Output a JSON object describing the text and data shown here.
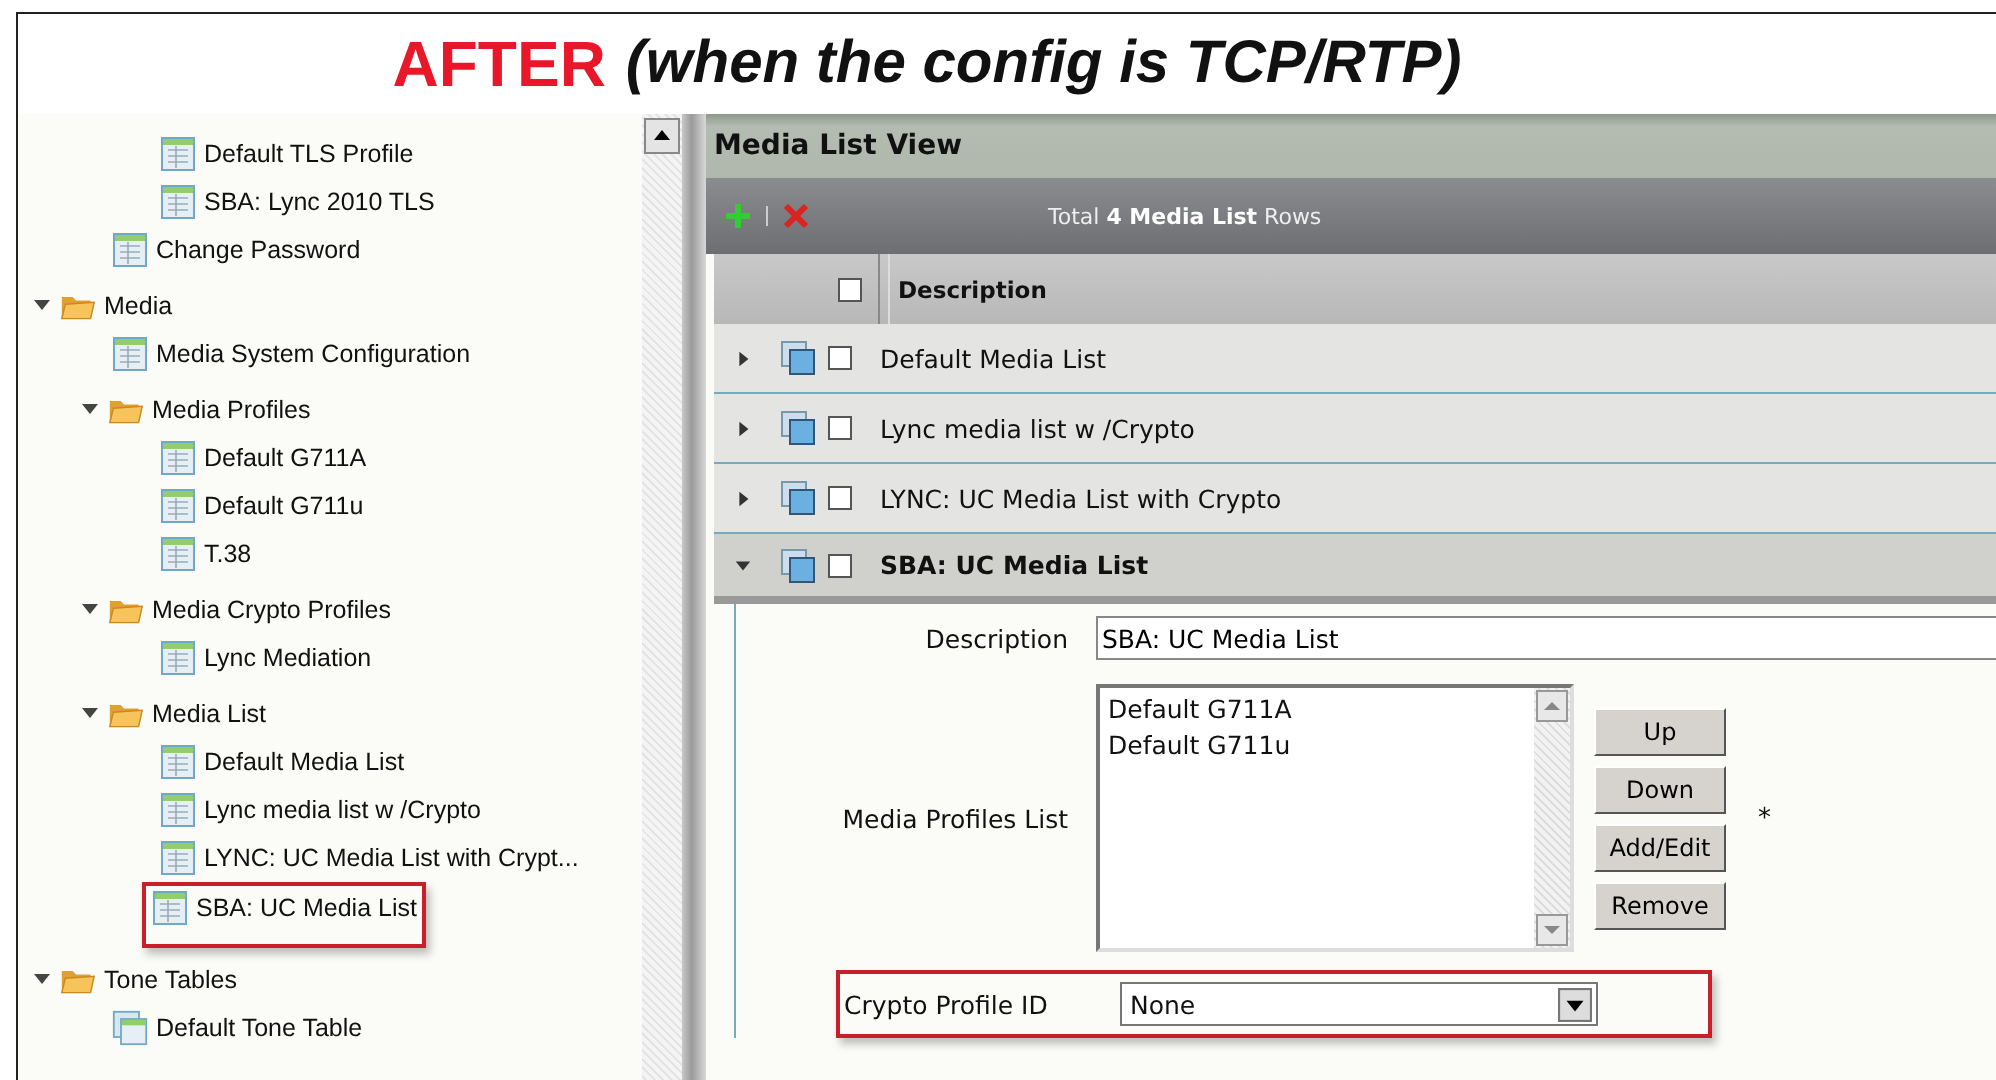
{
  "banner": {
    "emphasis": "AFTER",
    "text": "(when the config is TCP/RTP)"
  },
  "tree": [
    {
      "children": [
        {
          "children": [
            {
              "label": "Default TLS Profile",
              "kind": "table",
              "highlighted": false
            },
            {
              "label": "SBA: Lync 2010 TLS",
              "kind": "table",
              "highlighted": false
            }
          ]
        },
        {
          "label": "Change Password",
          "kind": "table",
          "highlighted": false
        }
      ]
    },
    {
      "label": "Media",
      "kind": "folder",
      "expanded": true,
      "highlighted": false,
      "children": [
        {
          "label": "Media System Configuration",
          "kind": "table",
          "highlighted": false
        },
        {
          "label": "Media Profiles",
          "kind": "folder",
          "expanded": true,
          "highlighted": false,
          "children": [
            {
              "label": "Default G711A",
              "kind": "table",
              "highlighted": false
            },
            {
              "label": "Default G711u",
              "kind": "table",
              "highlighted": false
            },
            {
              "label": "T.38",
              "kind": "table",
              "highlighted": false
            }
          ]
        },
        {
          "label": "Media Crypto Profiles",
          "kind": "folder",
          "expanded": true,
          "highlighted": false,
          "children": [
            {
              "label": "Lync Mediation",
              "kind": "table",
              "highlighted": false
            }
          ]
        },
        {
          "label": "Media List",
          "kind": "folder",
          "expanded": true,
          "highlighted": false,
          "children": [
            {
              "label": "Default Media List",
              "kind": "table",
              "highlighted": false
            },
            {
              "label": "Lync media list w /Crypto",
              "kind": "table",
              "highlighted": false
            },
            {
              "label": "LYNC: UC Media List with Crypt...",
              "kind": "table",
              "highlighted": false
            },
            {
              "label": "SBA: UC Media List",
              "kind": "table",
              "highlighted": true
            }
          ]
        }
      ]
    },
    {
      "label": "Tone Tables",
      "kind": "folder",
      "expanded": true,
      "highlighted": false,
      "children": [
        {
          "label": "Default Tone Table",
          "kind": "stack",
          "highlighted": false
        }
      ]
    }
  ],
  "panel": {
    "title": "Media List View",
    "summary": "Total **4 Media List** Rows",
    "column": "Description",
    "header_checked": false,
    "rows": [
      {
        "description": "Default Media List",
        "expanded": false,
        "checked": false
      },
      {
        "description": "Lync media list w /Crypto",
        "expanded": false,
        "checked": false
      },
      {
        "description": "LYNC: UC Media List with Crypto",
        "expanded": false,
        "checked": false
      },
      {
        "description": "SBA: UC Media List",
        "expanded": true,
        "checked": false
      }
    ],
    "form": {
      "description_label": "Description",
      "description_value": "SBA: UC Media List",
      "profiles_label": "Media Profiles List",
      "profiles": [
        "Default G711A",
        "Default G711u"
      ],
      "buttons": [
        "Up",
        "Down",
        "Add/Edit",
        "Remove"
      ],
      "required_mark": "*",
      "crypto_label": "Crypto Profile ID",
      "crypto_value": "None",
      "crypto_highlighted": true
    }
  }
}
